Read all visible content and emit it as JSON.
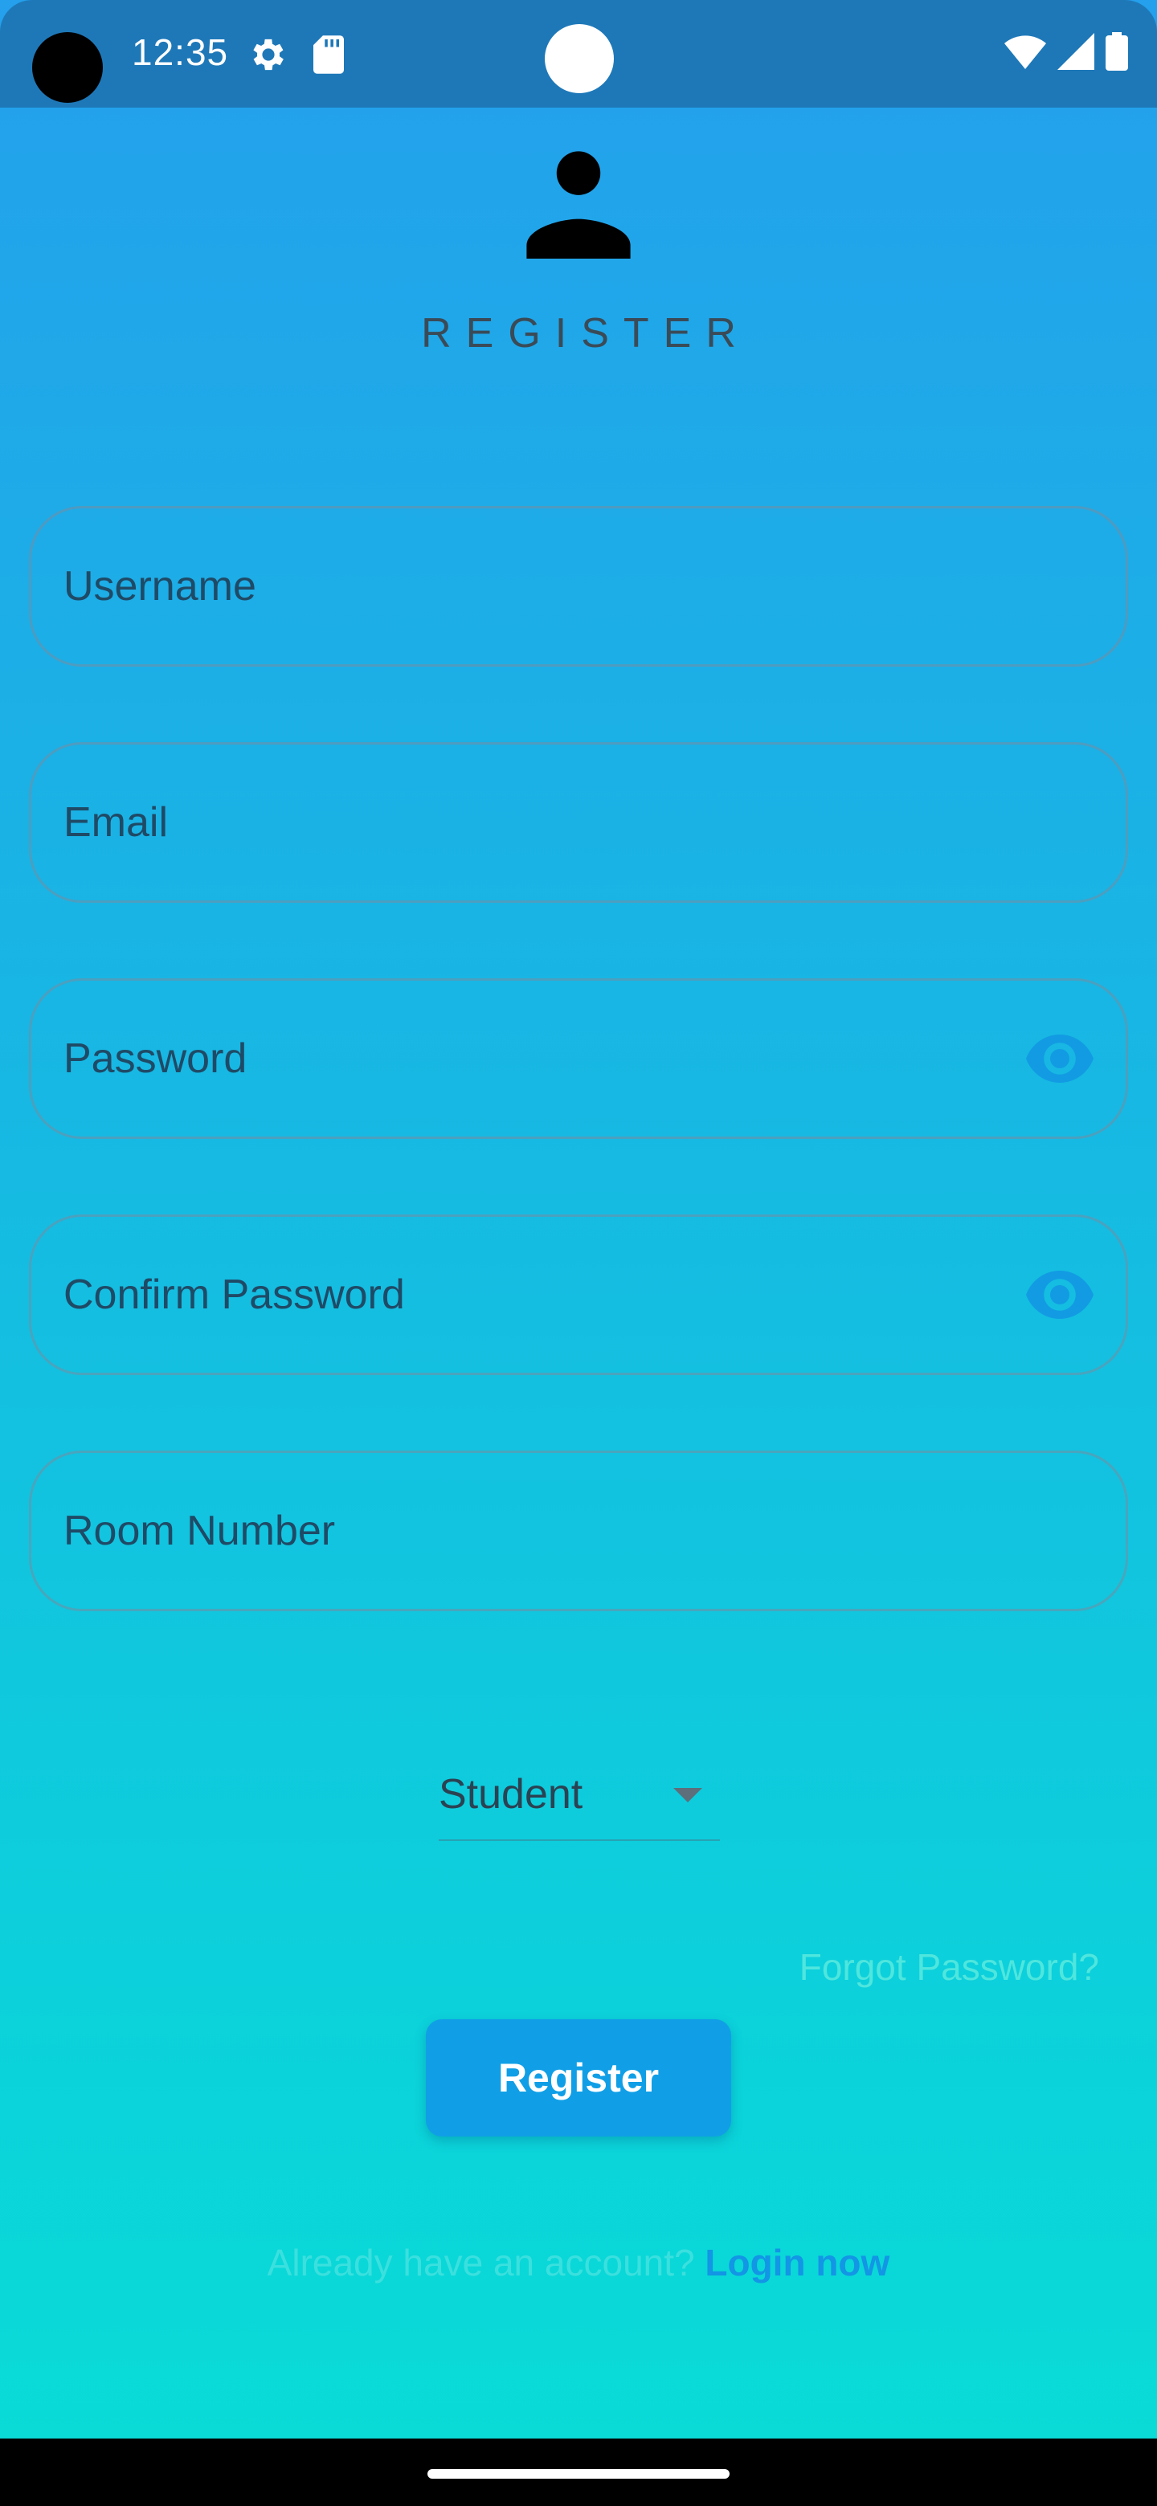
{
  "status_bar": {
    "time": "12:35",
    "icons": [
      "gear-icon",
      "sd-card-icon",
      "wifi-icon",
      "cell-signal-icon",
      "battery-icon"
    ]
  },
  "header": {
    "icon": "person-icon",
    "title": "REGISTER"
  },
  "form": {
    "username": {
      "label": "Username"
    },
    "email": {
      "label": "Email"
    },
    "password": {
      "label": "Password"
    },
    "confirm_password": {
      "label": "Confirm Password"
    },
    "room_number": {
      "label": "Room Number"
    },
    "role": {
      "selected": "Student"
    }
  },
  "links": {
    "forgot_password": "Forgot Password?",
    "login_prompt": "Already have an account?",
    "login_now": "Login now"
  },
  "buttons": {
    "register": "Register"
  },
  "colors": {
    "status_bar": "#1e78b8",
    "gradient_top": "#24a0ec",
    "gradient_bottom": "#0adbd7",
    "button": "#109fe6",
    "login_link": "#1296e5",
    "accent_text": "#4fe6de"
  }
}
